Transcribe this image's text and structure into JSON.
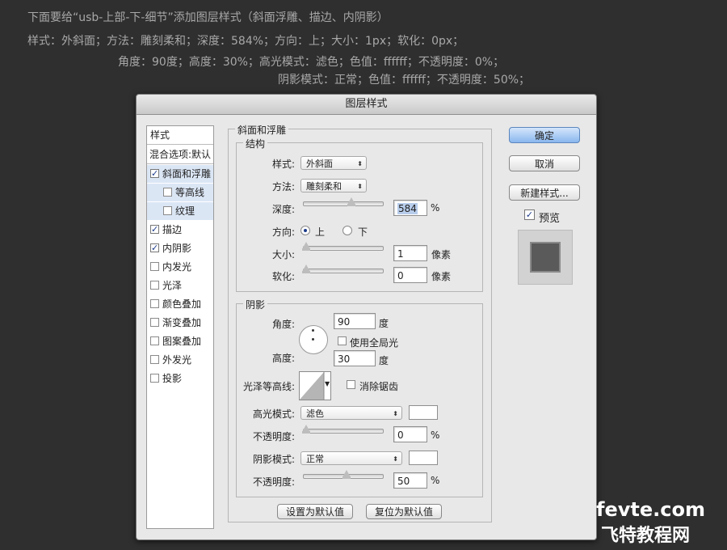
{
  "tutorial": {
    "line1": "下面要给“usb-上部-下-细节”添加图层样式（斜面浮雕、描边、内阴影）",
    "line2": "样式：外斜面；方法：雕刻柔和；深度：584%；方向：上；大小：1px；软化：0px；",
    "line3": "角度：90度；高度：30%；高光模式：滤色；色值：ffffff；不透明度：0%；",
    "line4": "阴影模式：正常；色值：ffffff；不透明度：50%；"
  },
  "dialog": {
    "title": "图层样式",
    "left_panel": {
      "header": "样式",
      "blend_default": "混合选项:默认",
      "items": [
        {
          "label": "斜面和浮雕",
          "checked": true
        },
        {
          "label": "等高线",
          "checked": false
        },
        {
          "label": "纹理",
          "checked": false
        },
        {
          "label": "描边",
          "checked": true
        },
        {
          "label": "内阴影",
          "checked": true
        },
        {
          "label": "内发光",
          "checked": false
        },
        {
          "label": "光泽",
          "checked": false
        },
        {
          "label": "颜色叠加",
          "checked": false
        },
        {
          "label": "渐变叠加",
          "checked": false
        },
        {
          "label": "图案叠加",
          "checked": false
        },
        {
          "label": "外发光",
          "checked": false
        },
        {
          "label": "投影",
          "checked": false
        }
      ]
    },
    "bevel": {
      "group_title": "斜面和浮雕",
      "structure_title": "结构",
      "style_label": "样式:",
      "style_value": "外斜面",
      "technique_label": "方法:",
      "technique_value": "雕刻柔和",
      "depth_label": "深度:",
      "depth_value": "584",
      "percent": "%",
      "direction_label": "方向:",
      "direction_up": "上",
      "direction_down": "下",
      "size_label": "大小:",
      "size_value": "1",
      "px_unit": "像素",
      "soften_label": "软化:",
      "soften_value": "0"
    },
    "shading": {
      "title": "阴影",
      "angle_label": "角度:",
      "angle_value": "90",
      "degree": "度",
      "global_light": "使用全局光",
      "altitude_label": "高度:",
      "altitude_value": "30",
      "gloss_label": "光泽等高线:",
      "anti_alias": "消除锯齿",
      "highlight_mode_label": "高光模式:",
      "highlight_mode_value": "滤色",
      "opacity_label": "不透明度:",
      "highlight_opacity": "0",
      "shadow_mode_label": "阴影模式:",
      "shadow_mode_value": "正常",
      "shadow_opacity": "50",
      "percent": "%"
    },
    "buttons": {
      "ok": "确定",
      "cancel": "取消",
      "new_style": "新建样式...",
      "preview": "预览",
      "set_default": "设置为默认值",
      "reset_default": "复位为默认值"
    },
    "colors": {
      "highlight": "#ffffff",
      "shadow": "#ffffff"
    }
  },
  "watermark": {
    "line1": "fevte.com",
    "line2": "飞特教程网"
  }
}
